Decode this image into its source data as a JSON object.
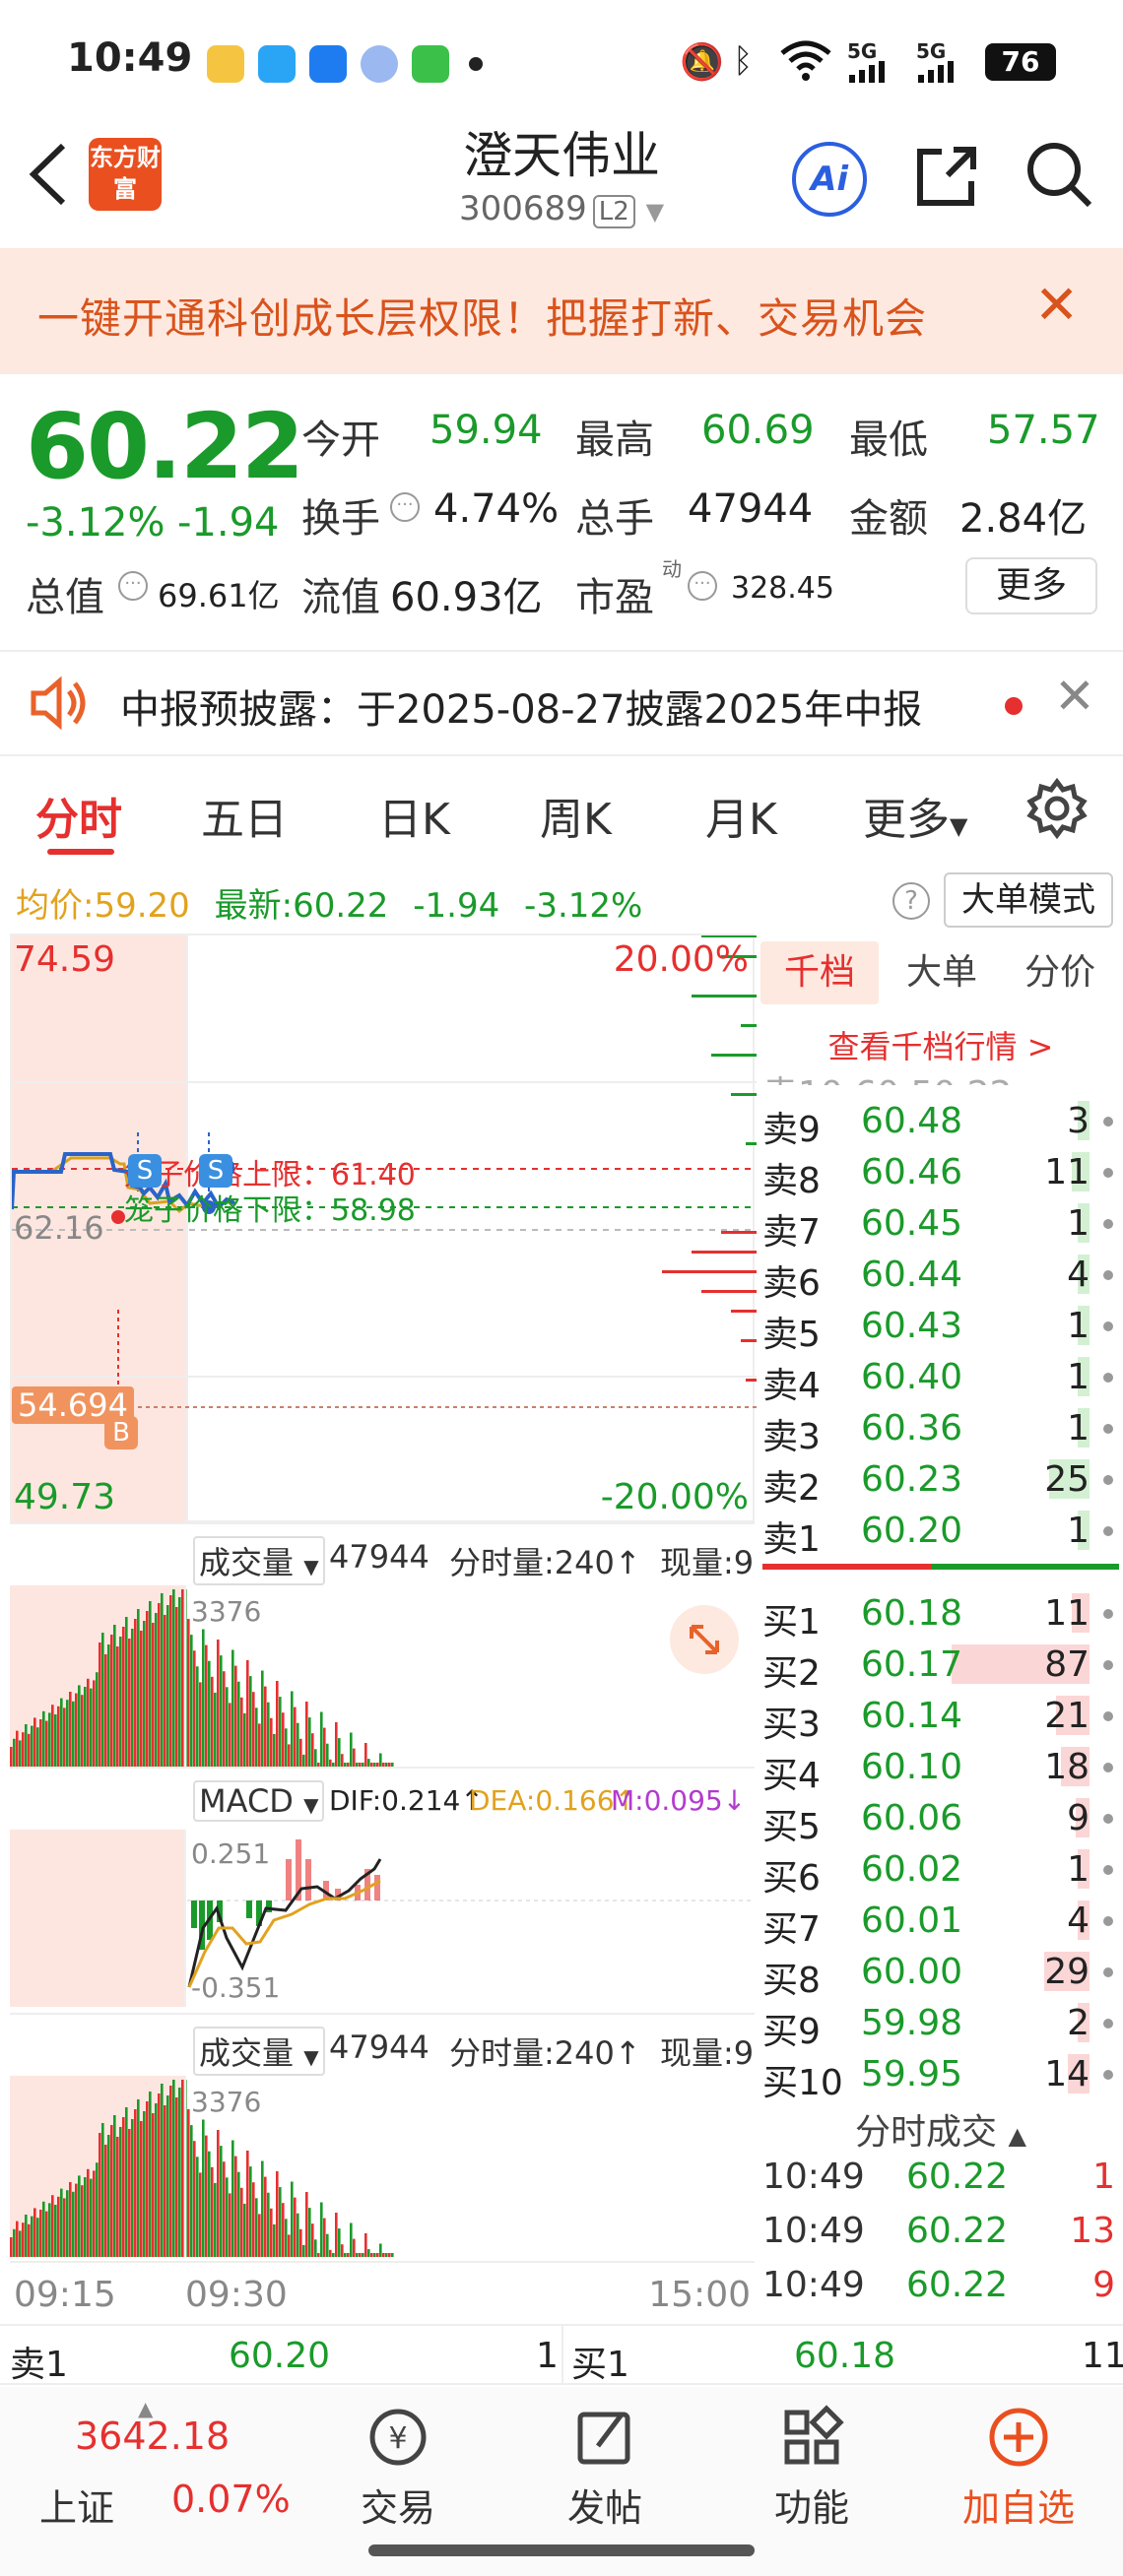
{
  "status_bar": {
    "time": "10:49",
    "signal1": "5G",
    "signal2": "5G",
    "battery": "76"
  },
  "header": {
    "logo_text": "东方财富",
    "stock_name": "澄天伟业",
    "stock_code": "300689",
    "level_badge": "L2",
    "ai_label": "Ai"
  },
  "banner": {
    "text": "一键开通科创成长层权限！把握打新、交易机会"
  },
  "quote": {
    "price": "60.22",
    "change_pct": "-3.12%",
    "change": "-1.94",
    "open_label": "今开",
    "open": "59.94",
    "high_label": "最高",
    "high": "60.69",
    "low_label": "最低",
    "low": "57.57",
    "turnover_label": "换手",
    "turnover": "4.74%",
    "volume_label": "总手",
    "volume": "47944",
    "amount_label": "金额",
    "amount": "2.84亿",
    "mktcap_label": "总值",
    "mktcap": "69.61亿",
    "float_label": "流值",
    "float_cap": "60.93亿",
    "pe_label": "市盈",
    "pe_sup": "动",
    "pe": "328.45",
    "more_label": "更多"
  },
  "notice": {
    "text": "中报预披露：于2025-08-27披露2025年中报"
  },
  "tabs": [
    "分时",
    "五日",
    "日K",
    "周K",
    "月K",
    "更多"
  ],
  "avg_line": {
    "avg_label": "均价:",
    "avg": "59.20",
    "latest_label": "最新:",
    "latest": "60.22",
    "chg": "-1.94",
    "pct": "-3.12%",
    "mode_label": "大单模式"
  },
  "chart": {
    "y_top": "74.59",
    "y_pct_top": "20.00%",
    "y_mid": "62.16",
    "y_bottom": "49.73",
    "y_pct_bottom": "-20.00%",
    "marker_price": "54.694",
    "cage_upper_label": "笼子价格上限：",
    "cage_upper": "61.40",
    "cage_lower_label": "笼子价格下限：",
    "cage_lower": "58.98",
    "s_marker": "S",
    "b_marker": "B",
    "vol_label": "成交量",
    "vol_total": "47944",
    "vol_period": "分时量:240↑",
    "vol_now": "现量:9",
    "vol_max": "3376",
    "macd_label": "MACD",
    "dif": "DIF:0.214↑",
    "dea": "DEA:0.166↑",
    "m": "M:0.095↓",
    "macd_top": "0.251",
    "macd_bottom": "-0.351",
    "vol2_label": "成交量",
    "vol2_total": "47944",
    "vol2_period": "分时量:240↑",
    "vol2_now": "现量:9",
    "vol2_max": "3376",
    "time_start": "09:15",
    "time_mid": "09:30",
    "time_end": "15:00"
  },
  "orderbook": {
    "tabs": [
      "千档",
      "大单",
      "分价"
    ],
    "view_link": "查看千档行情 >",
    "asks": [
      {
        "label": "卖9",
        "price": "60.48",
        "vol": "3",
        "bar": 0.03
      },
      {
        "label": "卖8",
        "price": "60.46",
        "vol": "11",
        "bar": 0.13
      },
      {
        "label": "卖7",
        "price": "60.45",
        "vol": "1",
        "bar": 0.01
      },
      {
        "label": "卖6",
        "price": "60.44",
        "vol": "4",
        "bar": 0.05
      },
      {
        "label": "卖5",
        "price": "60.43",
        "vol": "1",
        "bar": 0.01
      },
      {
        "label": "卖4",
        "price": "60.40",
        "vol": "1",
        "bar": 0.01
      },
      {
        "label": "卖3",
        "price": "60.36",
        "vol": "1",
        "bar": 0.01
      },
      {
        "label": "卖2",
        "price": "60.23",
        "vol": "25",
        "bar": 0.29
      },
      {
        "label": "卖1",
        "price": "60.20",
        "vol": "1",
        "bar": 0.01
      }
    ],
    "bids": [
      {
        "label": "买1",
        "price": "60.18",
        "vol": "11",
        "bar": 0.13
      },
      {
        "label": "买2",
        "price": "60.17",
        "vol": "87",
        "bar": 1.0
      },
      {
        "label": "买3",
        "price": "60.14",
        "vol": "21",
        "bar": 0.24
      },
      {
        "label": "买4",
        "price": "60.10",
        "vol": "18",
        "bar": 0.21
      },
      {
        "label": "买5",
        "price": "60.06",
        "vol": "9",
        "bar": 0.1
      },
      {
        "label": "买6",
        "price": "60.02",
        "vol": "1",
        "bar": 0.01
      },
      {
        "label": "买7",
        "price": "60.01",
        "vol": "4",
        "bar": 0.05
      },
      {
        "label": "买8",
        "price": "60.00",
        "vol": "29",
        "bar": 0.33
      },
      {
        "label": "买9",
        "price": "59.98",
        "vol": "2",
        "bar": 0.02
      },
      {
        "label": "买10",
        "price": "59.95",
        "vol": "14",
        "bar": 0.16
      }
    ],
    "trades_title": "分时成交",
    "trades": [
      {
        "time": "10:49",
        "price": "60.22",
        "vol": "1"
      },
      {
        "time": "10:49",
        "price": "60.22",
        "vol": "13"
      },
      {
        "time": "10:49",
        "price": "60.22",
        "vol": "9"
      }
    ]
  },
  "best_row": {
    "ask_label": "卖1",
    "ask_price": "60.20",
    "ask_vol": "1",
    "bid_label": "买1",
    "bid_price": "60.18",
    "bid_vol": "11"
  },
  "bottom_nav": {
    "index_value": "3642.18",
    "index_name": "上证",
    "index_pct": "0.07%",
    "items": [
      "交易",
      "发帖",
      "功能",
      "加自选"
    ]
  },
  "colors": {
    "up": "#e5302f",
    "down": "#1a9a2a",
    "accent": "#ea4f1f",
    "price_line": "#2a64c8"
  }
}
